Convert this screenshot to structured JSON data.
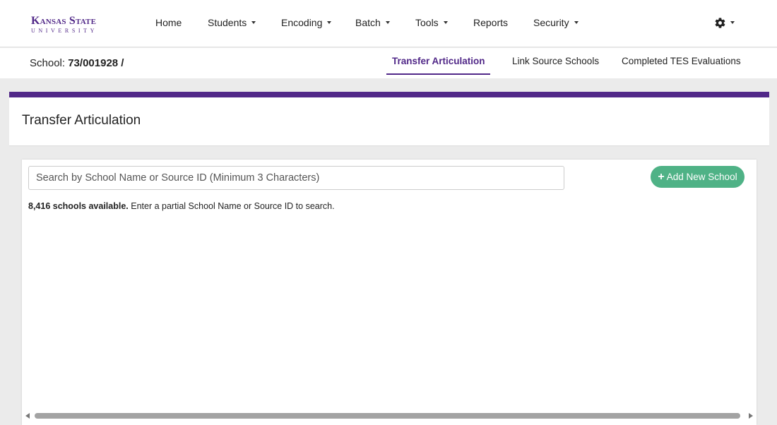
{
  "brand": {
    "line1": "Kansas State",
    "line2": "UNIVERSITY"
  },
  "nav": {
    "items": [
      {
        "label": "Home",
        "dropdown": false
      },
      {
        "label": "Students",
        "dropdown": true
      },
      {
        "label": "Encoding",
        "dropdown": true
      },
      {
        "label": "Batch",
        "dropdown": true
      },
      {
        "label": "Tools",
        "dropdown": true
      },
      {
        "label": "Reports",
        "dropdown": false
      },
      {
        "label": "Security",
        "dropdown": true
      }
    ],
    "settings_icon": "gear-icon"
  },
  "subbar": {
    "school_label": "School:",
    "school_value": "73/001928 /",
    "tabs": [
      {
        "label": "Transfer Articulation",
        "active": true
      },
      {
        "label": "Link Source Schools",
        "active": false
      },
      {
        "label": "Completed TES Evaluations",
        "active": false
      }
    ]
  },
  "panel": {
    "title": "Transfer Articulation",
    "search": {
      "placeholder": "Search by School Name or Source ID (Minimum 3 Characters)",
      "value": ""
    },
    "add_button": {
      "icon": "plus-icon",
      "label": "Add New School"
    },
    "status": {
      "count_text": "8,416 schools available.",
      "hint_text": "Enter a partial School Name or Source ID to search."
    }
  },
  "colors": {
    "accent": "#512888",
    "button_green": "#4fb286",
    "page_bg": "#ebebeb"
  }
}
